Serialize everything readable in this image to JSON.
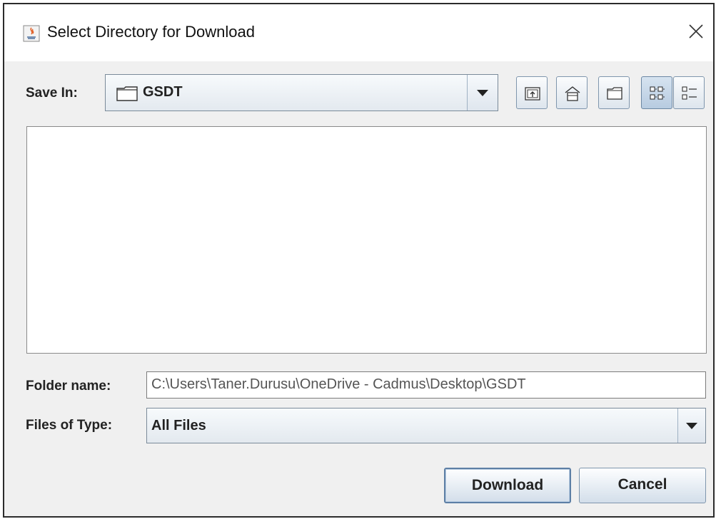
{
  "dialog": {
    "title": "Select Directory for Download"
  },
  "save_in": {
    "label": "Save In:",
    "label_mnemonic": "I",
    "value": "GSDT"
  },
  "toolbar": {
    "buttons": [
      {
        "name": "up-one-level",
        "icon": "folder-up-icon"
      },
      {
        "name": "home",
        "icon": "home-icon"
      },
      {
        "name": "new-folder",
        "icon": "new-folder-icon"
      },
      {
        "name": "list-view",
        "icon": "list-view-icon",
        "selected": true
      },
      {
        "name": "details-view",
        "icon": "details-view-icon"
      }
    ]
  },
  "folder_name": {
    "label": "Folder name:",
    "label_mnemonic": "n",
    "value": "C:\\Users\\Taner.Durusu\\OneDrive - Cadmus\\Desktop\\GSDT"
  },
  "files_of_type": {
    "label": "Files of Type:",
    "label_mnemonic": "T",
    "value": "All Files"
  },
  "actions": {
    "download": "Download",
    "cancel": "Cancel"
  },
  "colors": {
    "dialog_bg": "#f0f0f0",
    "button_border": "#7f96ad",
    "selected_toggle": "#c3d4e6"
  }
}
